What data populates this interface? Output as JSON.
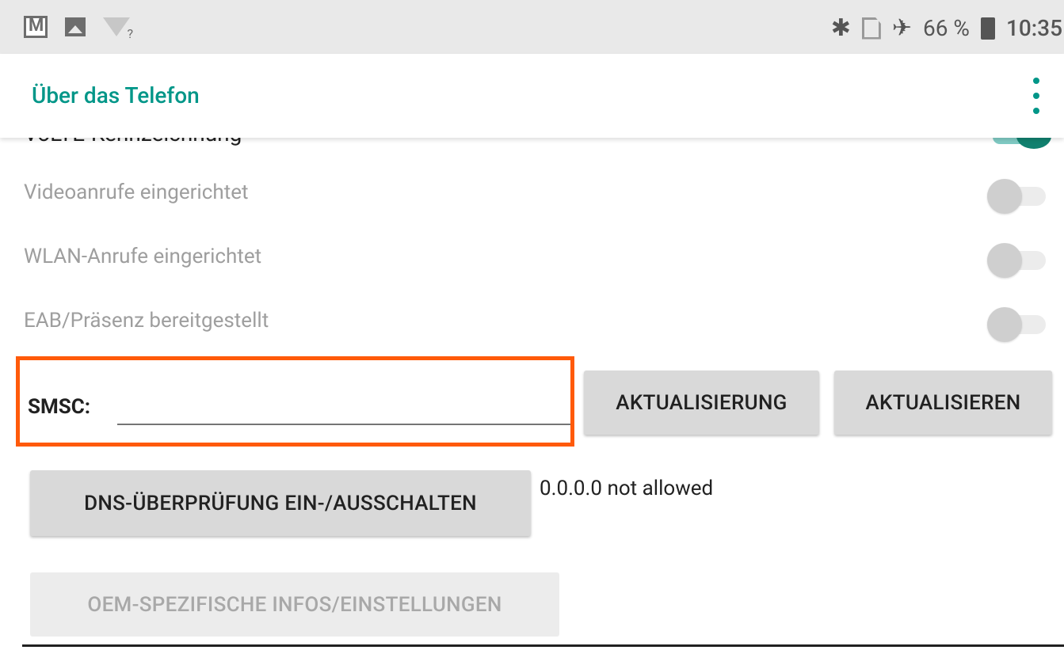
{
  "status_bar": {
    "left_icons": [
      "gmail-icon",
      "image-icon",
      "wifi-unknown-icon"
    ],
    "right_icons": [
      "bluetooth-icon",
      "no-sim-icon",
      "airplane-icon"
    ],
    "battery": "66 %",
    "time": "10:35"
  },
  "app_bar": {
    "title": "Über das Telefon",
    "overflow_icon": "more-vert-icon"
  },
  "prefs": [
    {
      "label": "Videoanrufe eingerichtet",
      "checked": false,
      "enabled": false
    },
    {
      "label": "WLAN-Anrufe eingerichtet",
      "checked": false,
      "enabled": false
    },
    {
      "label": "EAB/Präsenz bereitgestellt",
      "checked": false,
      "enabled": false
    }
  ],
  "cut_row": {
    "label": "VoLTE-Kennzeichnung",
    "checked": true
  },
  "smsc": {
    "label": "SMSC:",
    "value": "",
    "update_button": "AKTUALISIERUNG",
    "refresh_button": "AKTUALISIEREN"
  },
  "dns": {
    "button": "DNS-ÜBERPRÜFUNG EIN-/AUSSCHALTEN",
    "status": "0.0.0.0 not allowed"
  },
  "oem": {
    "button": "OEM-SPEZIFISCHE INFOS/EINSTELLUNGEN",
    "enabled": false
  },
  "colors": {
    "accent": "#009688",
    "highlight_box": "#ff5a0a",
    "status_bar_bg": "#e9e9e9"
  }
}
